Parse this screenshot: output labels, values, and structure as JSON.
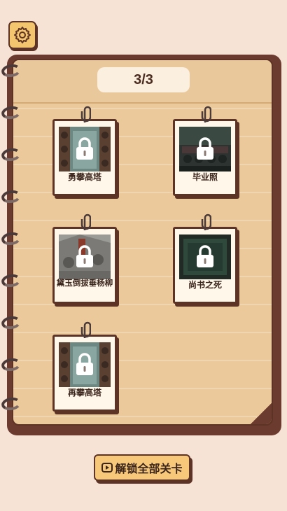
{
  "header": {
    "settings_icon": "gear-icon"
  },
  "notebook": {
    "page_indicator": "3/3"
  },
  "levels": [
    {
      "title": "勇攀高塔",
      "locked": true,
      "icon": "lock-icon"
    },
    {
      "title": "毕业照",
      "locked": true,
      "icon": "lock-icon"
    },
    {
      "title": "黛玉倒拔垂杨柳",
      "locked": true,
      "icon": "lock-icon"
    },
    {
      "title": "尚书之死",
      "locked": true,
      "icon": "lock-icon"
    },
    {
      "title": "再攀高塔",
      "locked": true,
      "icon": "lock-icon"
    }
  ],
  "footer": {
    "unlock_all_label": "解锁全部关卡",
    "unlock_icon": "video-play-icon"
  },
  "colors": {
    "background": "#f7e3d6",
    "paper": "#ebc99a",
    "border": "#5c3324",
    "button": "#f7c87a"
  }
}
